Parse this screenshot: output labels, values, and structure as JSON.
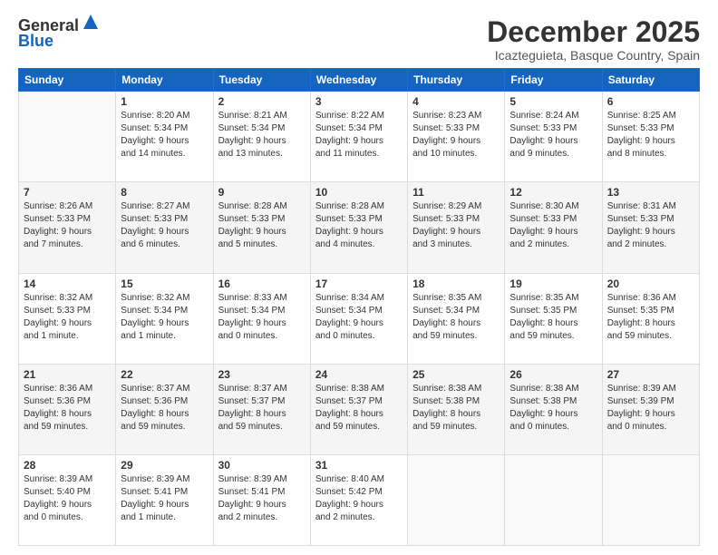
{
  "logo": {
    "general": "General",
    "blue": "Blue"
  },
  "header": {
    "month": "December 2025",
    "location": "Icazteguieta, Basque Country, Spain"
  },
  "weekdays": [
    "Sunday",
    "Monday",
    "Tuesday",
    "Wednesday",
    "Thursday",
    "Friday",
    "Saturday"
  ],
  "rows": [
    [
      {
        "day": "",
        "info": ""
      },
      {
        "day": "1",
        "info": "Sunrise: 8:20 AM\nSunset: 5:34 PM\nDaylight: 9 hours\nand 14 minutes."
      },
      {
        "day": "2",
        "info": "Sunrise: 8:21 AM\nSunset: 5:34 PM\nDaylight: 9 hours\nand 13 minutes."
      },
      {
        "day": "3",
        "info": "Sunrise: 8:22 AM\nSunset: 5:34 PM\nDaylight: 9 hours\nand 11 minutes."
      },
      {
        "day": "4",
        "info": "Sunrise: 8:23 AM\nSunset: 5:33 PM\nDaylight: 9 hours\nand 10 minutes."
      },
      {
        "day": "5",
        "info": "Sunrise: 8:24 AM\nSunset: 5:33 PM\nDaylight: 9 hours\nand 9 minutes."
      },
      {
        "day": "6",
        "info": "Sunrise: 8:25 AM\nSunset: 5:33 PM\nDaylight: 9 hours\nand 8 minutes."
      }
    ],
    [
      {
        "day": "7",
        "info": "Sunrise: 8:26 AM\nSunset: 5:33 PM\nDaylight: 9 hours\nand 7 minutes."
      },
      {
        "day": "8",
        "info": "Sunrise: 8:27 AM\nSunset: 5:33 PM\nDaylight: 9 hours\nand 6 minutes."
      },
      {
        "day": "9",
        "info": "Sunrise: 8:28 AM\nSunset: 5:33 PM\nDaylight: 9 hours\nand 5 minutes."
      },
      {
        "day": "10",
        "info": "Sunrise: 8:28 AM\nSunset: 5:33 PM\nDaylight: 9 hours\nand 4 minutes."
      },
      {
        "day": "11",
        "info": "Sunrise: 8:29 AM\nSunset: 5:33 PM\nDaylight: 9 hours\nand 3 minutes."
      },
      {
        "day": "12",
        "info": "Sunrise: 8:30 AM\nSunset: 5:33 PM\nDaylight: 9 hours\nand 2 minutes."
      },
      {
        "day": "13",
        "info": "Sunrise: 8:31 AM\nSunset: 5:33 PM\nDaylight: 9 hours\nand 2 minutes."
      }
    ],
    [
      {
        "day": "14",
        "info": "Sunrise: 8:32 AM\nSunset: 5:33 PM\nDaylight: 9 hours\nand 1 minute."
      },
      {
        "day": "15",
        "info": "Sunrise: 8:32 AM\nSunset: 5:34 PM\nDaylight: 9 hours\nand 1 minute."
      },
      {
        "day": "16",
        "info": "Sunrise: 8:33 AM\nSunset: 5:34 PM\nDaylight: 9 hours\nand 0 minutes."
      },
      {
        "day": "17",
        "info": "Sunrise: 8:34 AM\nSunset: 5:34 PM\nDaylight: 9 hours\nand 0 minutes."
      },
      {
        "day": "18",
        "info": "Sunrise: 8:35 AM\nSunset: 5:34 PM\nDaylight: 8 hours\nand 59 minutes."
      },
      {
        "day": "19",
        "info": "Sunrise: 8:35 AM\nSunset: 5:35 PM\nDaylight: 8 hours\nand 59 minutes."
      },
      {
        "day": "20",
        "info": "Sunrise: 8:36 AM\nSunset: 5:35 PM\nDaylight: 8 hours\nand 59 minutes."
      }
    ],
    [
      {
        "day": "21",
        "info": "Sunrise: 8:36 AM\nSunset: 5:36 PM\nDaylight: 8 hours\nand 59 minutes."
      },
      {
        "day": "22",
        "info": "Sunrise: 8:37 AM\nSunset: 5:36 PM\nDaylight: 8 hours\nand 59 minutes."
      },
      {
        "day": "23",
        "info": "Sunrise: 8:37 AM\nSunset: 5:37 PM\nDaylight: 8 hours\nand 59 minutes."
      },
      {
        "day": "24",
        "info": "Sunrise: 8:38 AM\nSunset: 5:37 PM\nDaylight: 8 hours\nand 59 minutes."
      },
      {
        "day": "25",
        "info": "Sunrise: 8:38 AM\nSunset: 5:38 PM\nDaylight: 8 hours\nand 59 minutes."
      },
      {
        "day": "26",
        "info": "Sunrise: 8:38 AM\nSunset: 5:38 PM\nDaylight: 9 hours\nand 0 minutes."
      },
      {
        "day": "27",
        "info": "Sunrise: 8:39 AM\nSunset: 5:39 PM\nDaylight: 9 hours\nand 0 minutes."
      }
    ],
    [
      {
        "day": "28",
        "info": "Sunrise: 8:39 AM\nSunset: 5:40 PM\nDaylight: 9 hours\nand 0 minutes."
      },
      {
        "day": "29",
        "info": "Sunrise: 8:39 AM\nSunset: 5:41 PM\nDaylight: 9 hours\nand 1 minute."
      },
      {
        "day": "30",
        "info": "Sunrise: 8:39 AM\nSunset: 5:41 PM\nDaylight: 9 hours\nand 2 minutes."
      },
      {
        "day": "31",
        "info": "Sunrise: 8:40 AM\nSunset: 5:42 PM\nDaylight: 9 hours\nand 2 minutes."
      },
      {
        "day": "",
        "info": ""
      },
      {
        "day": "",
        "info": ""
      },
      {
        "day": "",
        "info": ""
      }
    ]
  ]
}
